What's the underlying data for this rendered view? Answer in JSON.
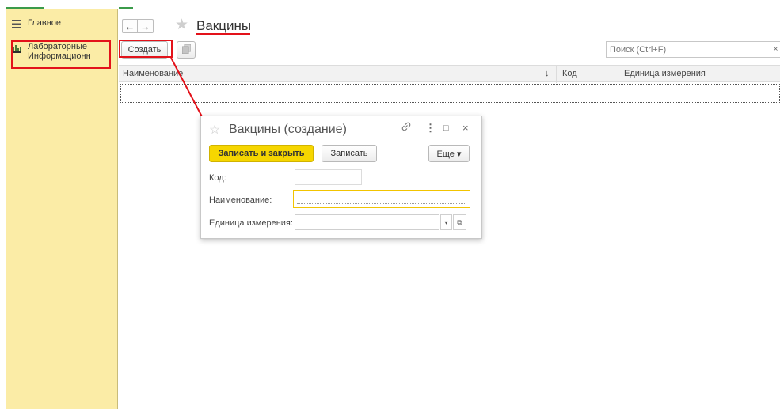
{
  "sidebar": {
    "items": [
      {
        "label": "Главное",
        "icon": "menu-lines-icon"
      },
      {
        "label": "Лабораторные Информационн...",
        "icon": "lab-chart-icon"
      }
    ]
  },
  "header": {
    "title": "Вакцины",
    "back_glyph": "←",
    "forward_glyph": "→",
    "star_glyph": "★"
  },
  "toolbar": {
    "create_label": "Создать",
    "search_placeholder": "Поиск (Ctrl+F)",
    "clear_glyph": "×"
  },
  "table": {
    "columns": [
      "Наименование",
      "Код",
      "Единица измерения"
    ],
    "sort_glyph": "↓",
    "rows": []
  },
  "dialog": {
    "title": "Вакцины (создание)",
    "star_glyph": "☆",
    "link_glyph": "🔗",
    "more_glyph": "⋮",
    "maximize_glyph": "□",
    "close_glyph": "×",
    "save_close_label": "Записать и закрыть",
    "save_label": "Записать",
    "more_label": "Еще ▾",
    "fields": {
      "code_label": "Код:",
      "code_value": "",
      "name_label": "Наименование:",
      "name_value": "",
      "unit_label": "Единица измерения:",
      "unit_value": ""
    },
    "dropdown_glyph": "▾",
    "open_glyph": "⧉"
  },
  "colors": {
    "sidebar_bg": "#fbeca6",
    "primary_button": "#f6d600",
    "annotation_red": "#e3121a",
    "accent_green": "#3b9b4a"
  }
}
